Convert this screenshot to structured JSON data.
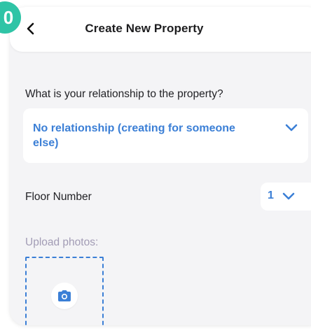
{
  "step_badge": "0",
  "header": {
    "title": "Create New Property",
    "back_icon": "chevron-left-icon"
  },
  "relationship": {
    "question": "What is your relationship to the property?",
    "selected_value": "No relationship (creating for someone else)",
    "icon": "chevron-down-icon"
  },
  "floor": {
    "label": "Floor Number",
    "selected_value": "1",
    "icon": "chevron-down-icon"
  },
  "upload": {
    "label": "Upload photos:",
    "icon": "camera-icon"
  },
  "colors": {
    "accent": "#3b7fd6",
    "badge": "#2fc4a6",
    "panel_bg": "#f4f4f6",
    "muted_label": "#a29cb5"
  }
}
